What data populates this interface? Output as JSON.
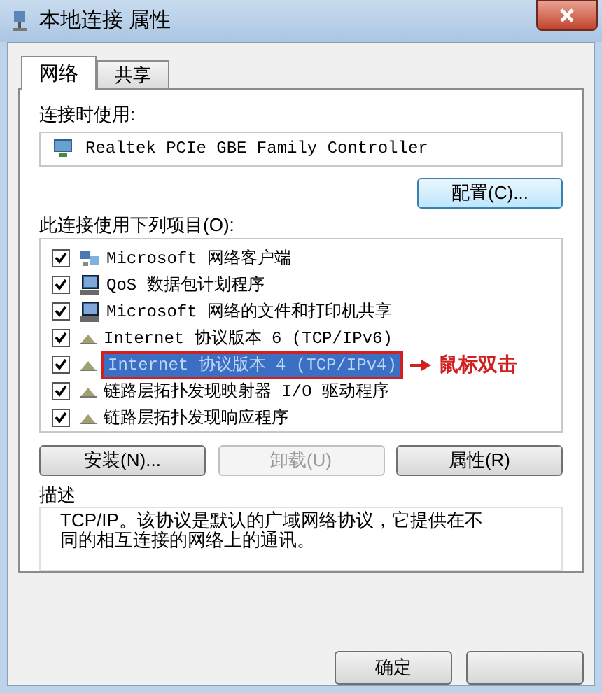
{
  "window": {
    "title": "本地连接 属性"
  },
  "tabs": [
    {
      "label": "网络",
      "selected": true
    },
    {
      "label": "共享",
      "selected": false
    }
  ],
  "connect_using": {
    "label": "连接时使用:",
    "adapter": "Realtek PCIe GBE Family Controller"
  },
  "configure_button": "配置(C)...",
  "items_label": "此连接使用下列项目(O):",
  "items": [
    {
      "kind": "client",
      "label": "Microsoft 网络客户端",
      "checked": true,
      "selected": false
    },
    {
      "kind": "computer",
      "label": "QoS 数据包计划程序",
      "checked": true,
      "selected": false
    },
    {
      "kind": "computer",
      "label": "Microsoft 网络的文件和打印机共享",
      "checked": true,
      "selected": false
    },
    {
      "kind": "protocol",
      "label": "Internet 协议版本 6 (TCP/IPv6)",
      "checked": true,
      "selected": false
    },
    {
      "kind": "protocol",
      "label": "Internet 协议版本 4 (TCP/IPv4)",
      "checked": true,
      "selected": true,
      "annotation": "鼠标双击"
    },
    {
      "kind": "protocol",
      "label": "链路层拓扑发现映射器 I/O 驱动程序",
      "checked": true,
      "selected": false
    },
    {
      "kind": "protocol",
      "label": "链路层拓扑发现响应程序",
      "checked": true,
      "selected": false
    }
  ],
  "item_buttons": [
    {
      "label": "安装(N)...",
      "disabled": false
    },
    {
      "label": "卸载(U)",
      "disabled": true
    },
    {
      "label": "属性(R)",
      "disabled": false
    }
  ],
  "description": {
    "label": "描述",
    "text": "TCP/IP。该协议是默认的广域网络协议，它提供在不同的相互连接的网络上的通讯。"
  },
  "dialog_buttons": [
    {
      "kind": "labelled",
      "label": "确定"
    },
    {
      "kind": "covered"
    }
  ]
}
